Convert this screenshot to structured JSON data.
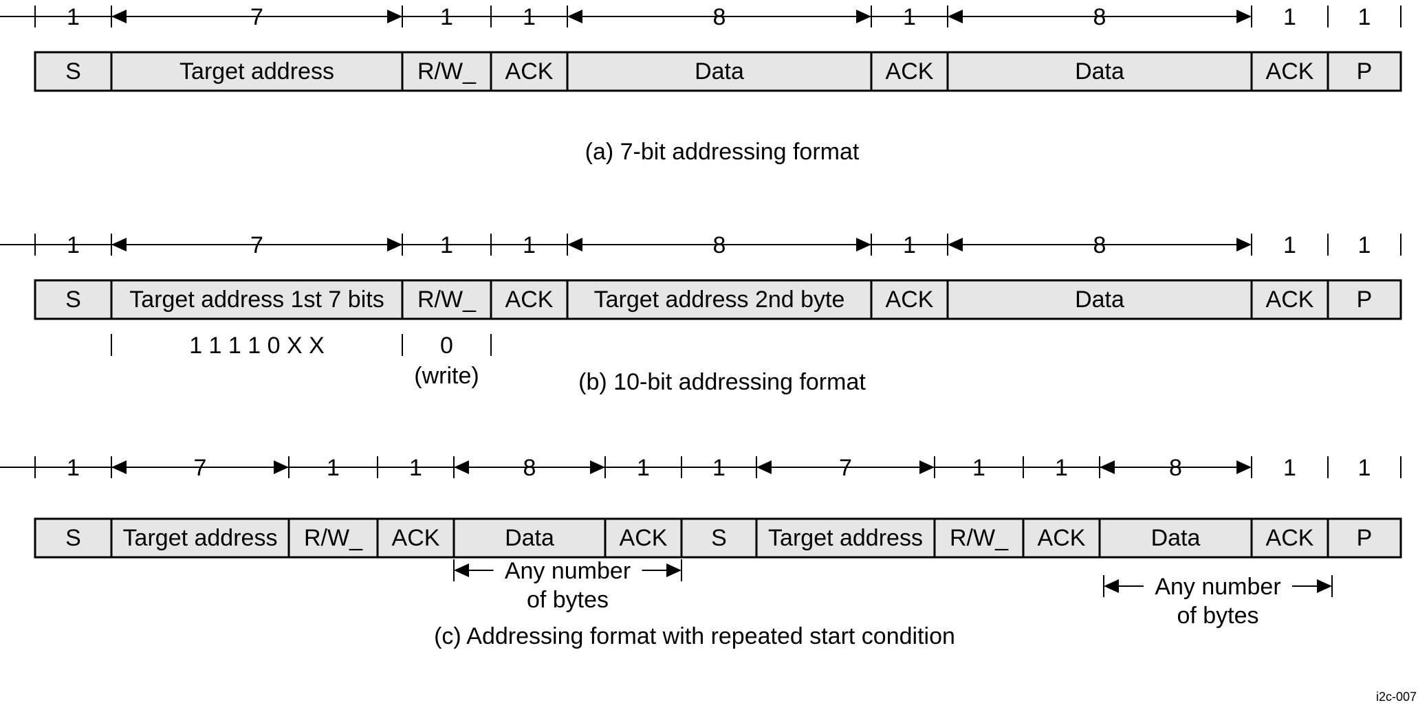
{
  "figure_id": "i2c-007",
  "colors": {
    "field_fill": "#e6e6e6",
    "stroke": "#000000"
  },
  "formats": [
    {
      "id": "a",
      "caption": "(a) 7-bit addressing format",
      "fields": [
        {
          "label": "S",
          "bits": "1"
        },
        {
          "label": "Target address",
          "bits": "7"
        },
        {
          "label": "R/W_",
          "bits": "1"
        },
        {
          "label": "ACK",
          "bits": "1"
        },
        {
          "label": "Data",
          "bits": "8"
        },
        {
          "label": "ACK",
          "bits": "1"
        },
        {
          "label": "Data",
          "bits": "8"
        },
        {
          "label": "ACK",
          "bits": "1"
        },
        {
          "label": "P",
          "bits": "1"
        }
      ],
      "annotations": []
    },
    {
      "id": "b",
      "caption": "(b) 10-bit addressing format",
      "fields": [
        {
          "label": "S",
          "bits": "1"
        },
        {
          "label": "Target address 1st 7 bits",
          "bits": "7"
        },
        {
          "label": "R/W_",
          "bits": "1"
        },
        {
          "label": "ACK",
          "bits": "1"
        },
        {
          "label": "Target address 2nd byte",
          "bits": "8"
        },
        {
          "label": "ACK",
          "bits": "1"
        },
        {
          "label": "Data",
          "bits": "8"
        },
        {
          "label": "ACK",
          "bits": "1"
        },
        {
          "label": "P",
          "bits": "1"
        }
      ],
      "annotations": [
        {
          "field_index": 1,
          "text": "1 1 1 1 0 X X"
        },
        {
          "field_index": 2,
          "text": "0",
          "subtext": "(write)"
        }
      ]
    },
    {
      "id": "c",
      "caption": "(c) Addressing format with repeated start condition",
      "fields": [
        {
          "label": "S",
          "bits": "1"
        },
        {
          "label": "Target address",
          "bits": "7"
        },
        {
          "label": "R/W_",
          "bits": "1"
        },
        {
          "label": "ACK",
          "bits": "1"
        },
        {
          "label": "Data",
          "bits": "8"
        },
        {
          "label": "ACK",
          "bits": "1"
        },
        {
          "label": "S",
          "bits": "1"
        },
        {
          "label": "Target address",
          "bits": "7"
        },
        {
          "label": "R/W_",
          "bits": "1"
        },
        {
          "label": "ACK",
          "bits": "1"
        },
        {
          "label": "Data",
          "bits": "8"
        },
        {
          "label": "ACK",
          "bits": "1"
        },
        {
          "label": "P",
          "bits": "1"
        }
      ],
      "spans": [
        {
          "from_field": 4,
          "to_field": 5,
          "line1": "Any number",
          "line2": "of bytes"
        },
        {
          "from_field": 10,
          "to_field": 11,
          "line1": "Any number",
          "line2": "of bytes"
        }
      ]
    }
  ]
}
